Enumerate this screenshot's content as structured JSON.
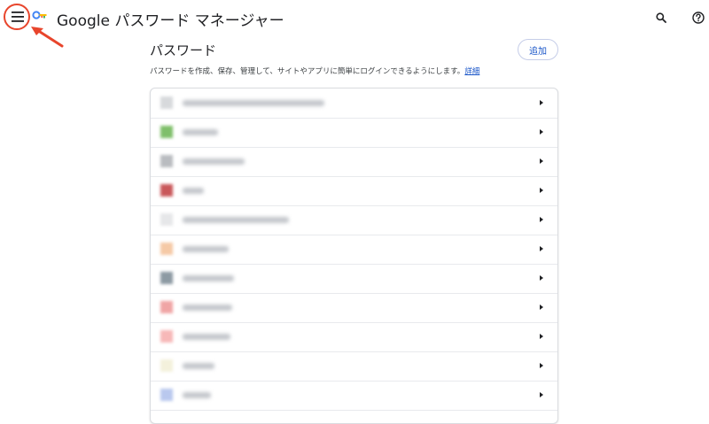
{
  "app": {
    "title": "Google パスワード マネージャー",
    "icons": {
      "menu": "hamburger-menu-icon",
      "logo": "key-icon",
      "search": "search-icon",
      "help": "help-icon"
    },
    "colors": {
      "accent": "#1a56c8",
      "annotation": "#e8452c"
    }
  },
  "page": {
    "title": "パスワード",
    "add_label": "追加",
    "description": "パスワードを作成、保存、管理して、サイトやアプリに簡単にログインできるようにします。",
    "details_link": "詳細"
  },
  "entries": [
    {
      "favicon": "#d7d9dc"
    },
    {
      "favicon": "#7fbf6a"
    },
    {
      "favicon": "#b9bcc0"
    },
    {
      "favicon": "#c9575a"
    },
    {
      "favicon": "#e6e7e9"
    },
    {
      "favicon": "#f5c9a6"
    },
    {
      "favicon": "#8d9aa3"
    },
    {
      "favicon": "#f0a5a5"
    },
    {
      "favicon": "#f7b8b8"
    },
    {
      "favicon": "#f4f1dc"
    },
    {
      "favicon": "#b9c8ee"
    }
  ]
}
